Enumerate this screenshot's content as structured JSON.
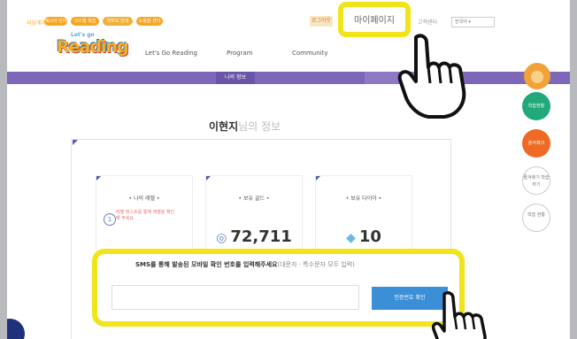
{
  "topbar": {
    "links": [
      "리딩게이트",
      "렉시아 단어",
      "코스별 학습",
      "학부모 안내",
      "도움말 센터"
    ],
    "login_label": "로그아웃",
    "mypage_label": "마이페이지",
    "after_mypage": "고객센터",
    "select_value": "한국어"
  },
  "logo": {
    "text": "Reading",
    "sub": "Let's go"
  },
  "nav": {
    "items": [
      "Let's Go Reading",
      "Program",
      "Community"
    ]
  },
  "band": {
    "active_tab": "나의 정보"
  },
  "page_title": {
    "name": "이현지",
    "suffix": "님의 정보"
  },
  "stats": [
    {
      "label": "나의 레벨",
      "note": "레벨 테스트를 통해 레벨을 확인해 주세요",
      "value": "1"
    },
    {
      "label": "보유 골드",
      "value": "72,711",
      "icon": "coin-icon"
    },
    {
      "label": "보유 다이아",
      "value": "10",
      "icon": "diamond-icon"
    }
  ],
  "side": {
    "green_label": "학습현황",
    "orange_label": "출석체크",
    "btn3_label": "즐겨찾기 학습하기",
    "btn4_label": "학습 현황"
  },
  "sms": {
    "prompt": "SMS를 통해 발송된 모바일 확인 번호를 입력해주세요",
    "hint": "(대문자 · 특수문자 모두 입력)",
    "input_value": "",
    "button_label": "인증번호 확인"
  },
  "colors": {
    "highlight": "#f2e41a",
    "purple": "#7d67b8",
    "blue_button": "#3a8fd6",
    "green": "#22a97a",
    "orange": "#ee6a25"
  }
}
